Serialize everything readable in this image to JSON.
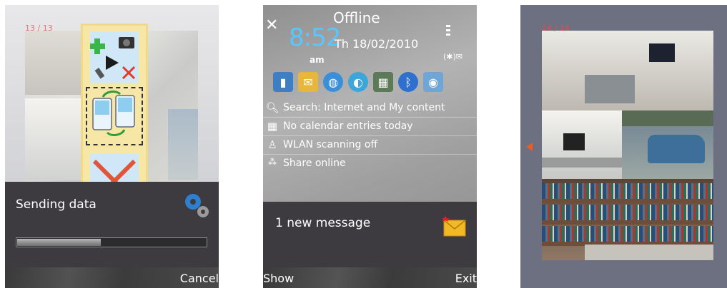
{
  "screen1": {
    "counter": "13 / 13",
    "panel_title": "Sending data",
    "progress_fraction": 0.44,
    "softkey_right": "Cancel"
  },
  "screen2": {
    "status": "Offline",
    "time": "8:52",
    "ampm": "am",
    "date": "Th 18/02/2010",
    "shortcuts": [
      "contacts-icon",
      "messaging-icon",
      "web-icon",
      "browser-icon",
      "calendar-icon",
      "bluetooth-icon",
      "camera-icon"
    ],
    "items": [
      {
        "icon": "search-icon",
        "text": "Search: Internet and My content"
      },
      {
        "icon": "calendar-icon",
        "text": "No calendar entries today"
      },
      {
        "icon": "wlan-icon",
        "text": "WLAN scanning off"
      },
      {
        "icon": "share-icon",
        "text": "Share online"
      }
    ],
    "notification": "1 new message",
    "softkey_left": "Show",
    "softkey_right": "Exit"
  },
  "screen3": {
    "counter": "14 / 14"
  },
  "colors": {
    "accent_blue": "#58c7ff",
    "counter_red": "#e24d4d",
    "panel_dark": "#3d3b3f"
  }
}
